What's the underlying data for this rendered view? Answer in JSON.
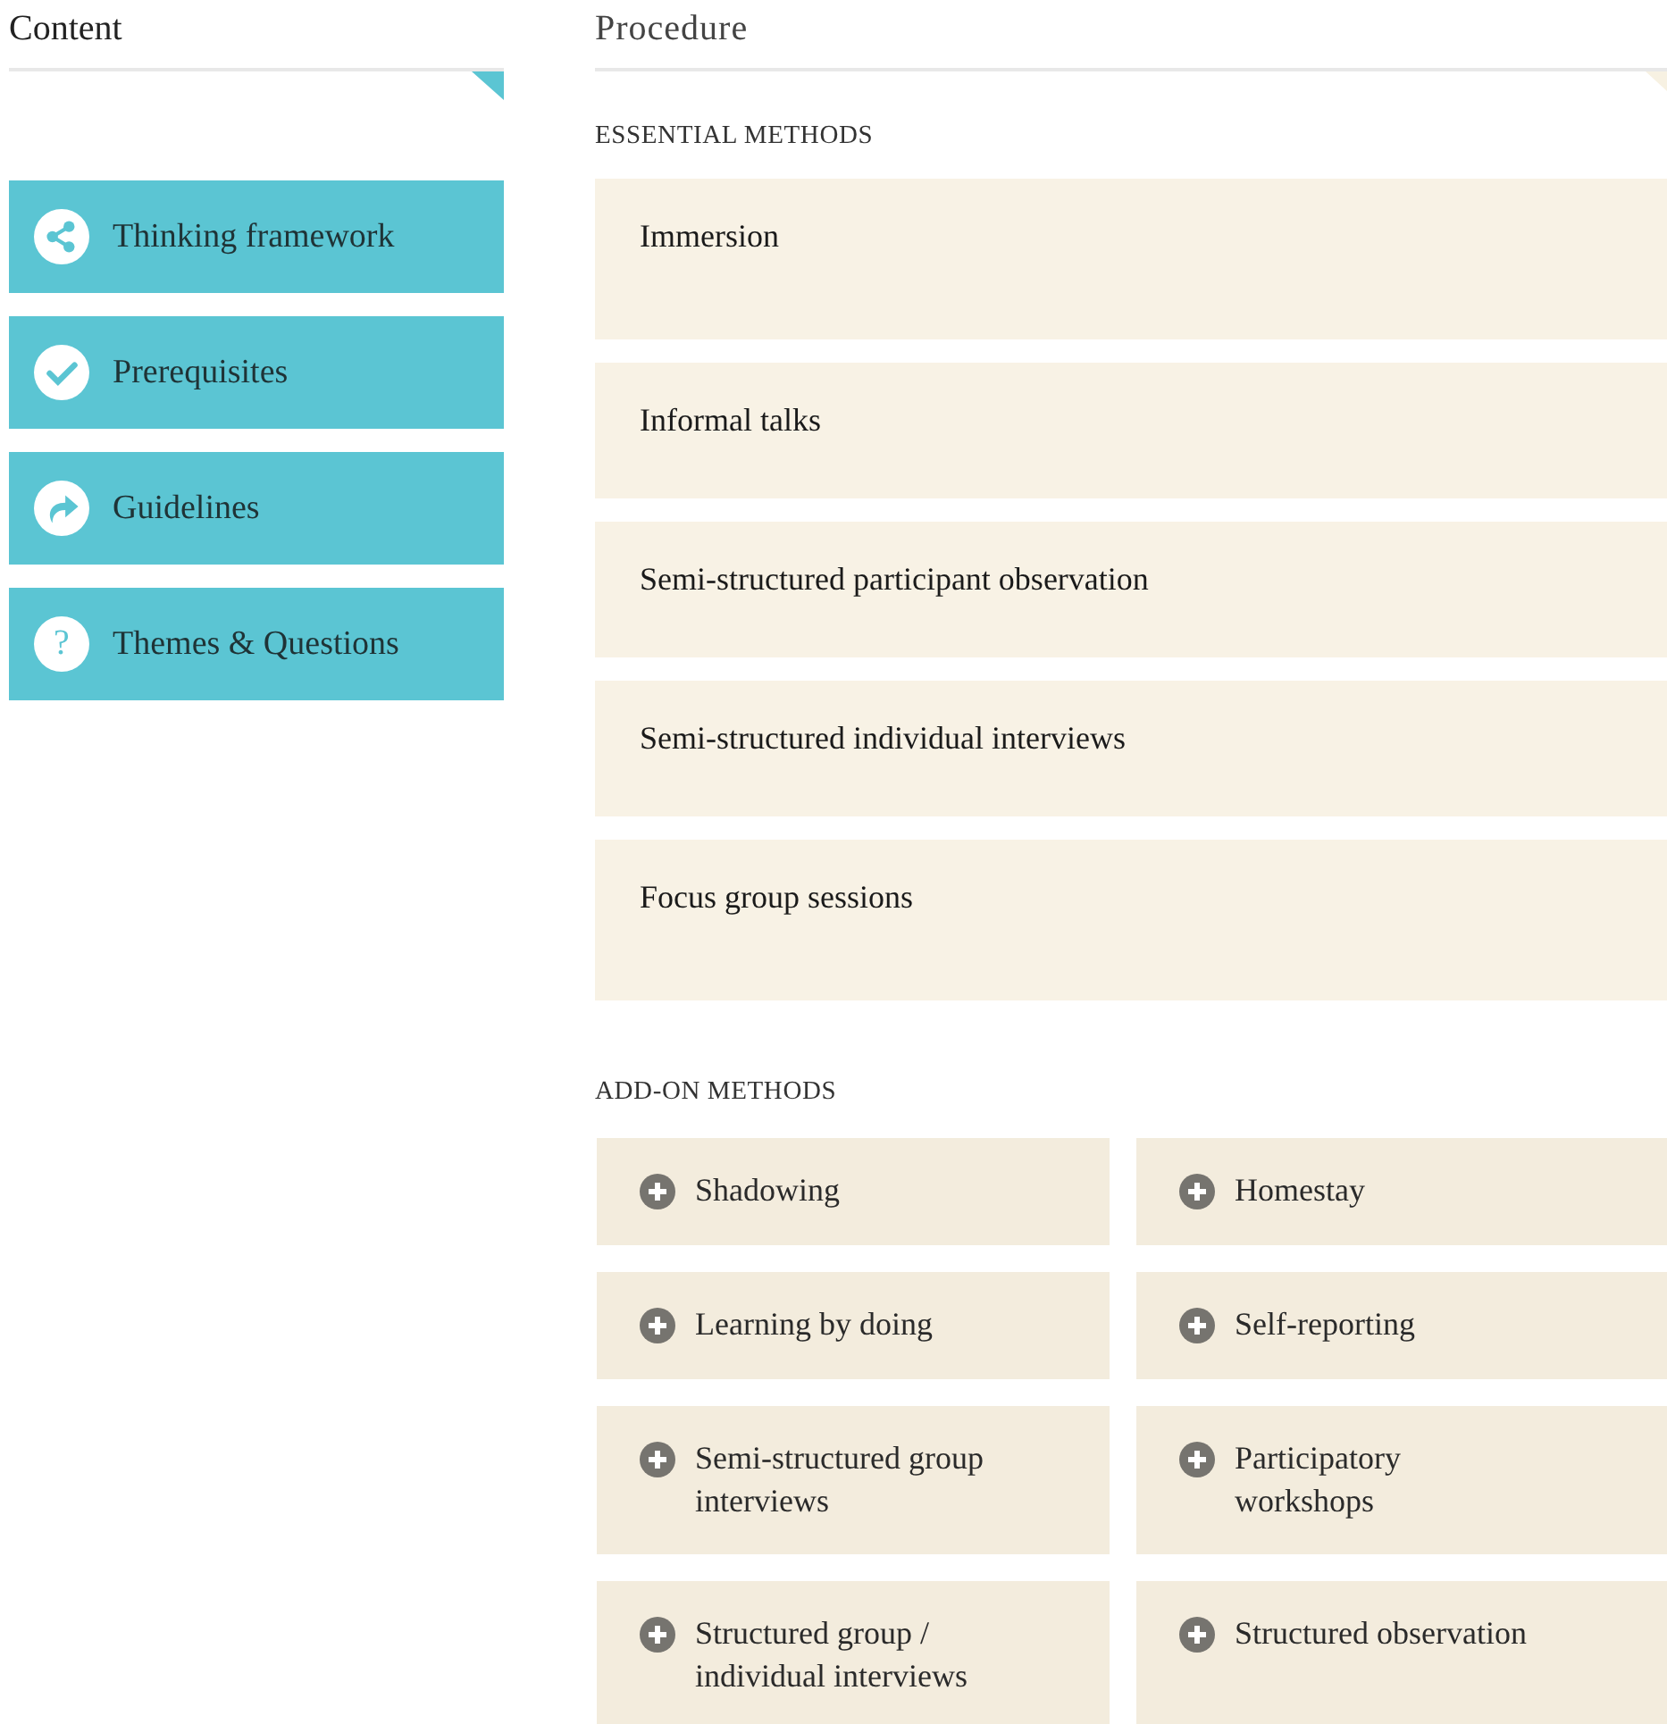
{
  "content": {
    "title": "Content",
    "items": [
      {
        "label": "Thinking framework",
        "kind": "share"
      },
      {
        "label": "Prerequisites",
        "kind": "check"
      },
      {
        "label": "Guidelines",
        "kind": "redo"
      },
      {
        "label": "Themes & Questions",
        "kind": "question",
        "icon_text": "?"
      }
    ]
  },
  "procedure": {
    "title": "Procedure",
    "essential": {
      "heading": "ESSENTIAL METHODS",
      "items": [
        "Immersion",
        "Informal talks",
        "Semi-structured participant observation",
        "Semi-structured individual interviews",
        "Focus group sessions"
      ]
    },
    "add_on": {
      "heading": "ADD-ON METHODS",
      "items": [
        "Shadowing",
        "Homestay",
        "Learning by doing",
        "Self-reporting",
        "Semi-structured group interviews",
        "Participatory workshops",
        "Structured group / individual interviews",
        "Structured observation"
      ]
    }
  }
}
